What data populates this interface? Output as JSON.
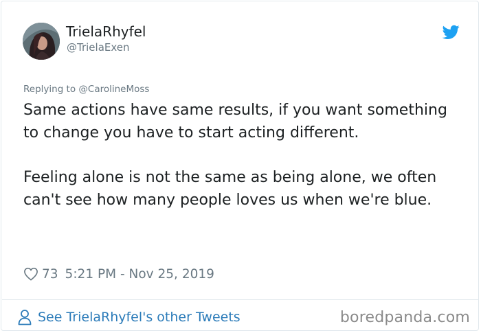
{
  "tweet": {
    "display_name": "TrielaRhyfel",
    "handle": "@TrielaExen",
    "replying_to": "Replying to @CarolineMoss",
    "paragraphs": [
      "Same actions have same results, if you want something to change you have to start acting different.",
      "Feeling alone is not the same as being alone, we often can't see how many people loves us when we're blue."
    ],
    "likes": "73",
    "timestamp": "5:21 PM - Nov 25, 2019"
  },
  "footer": {
    "see_more_label": "See TrielaRhyfel's other Tweets"
  },
  "watermark": "boredpanda.com",
  "icons": {
    "brand": "twitter-bird-icon",
    "like": "heart-outline-icon",
    "profile": "person-outline-icon"
  },
  "colors": {
    "twitter_blue": "#1da1f2",
    "link_blue": "#2b7bb9",
    "text": "#1c2022",
    "secondary_text": "#697882",
    "border": "#e1e8ed",
    "watermark": "#8a8a8a"
  }
}
